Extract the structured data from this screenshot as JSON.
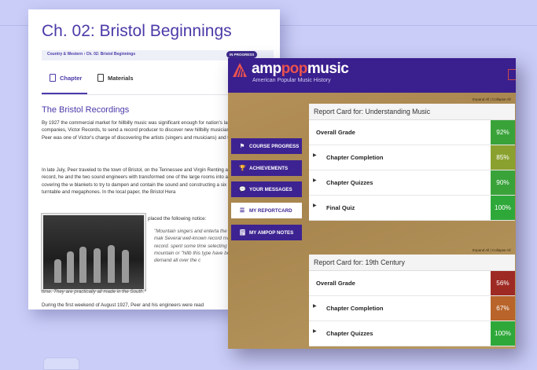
{
  "doc": {
    "title": "Ch. 02: Bristol Beginnings",
    "breadcrumb": "Country & Western › Ch. 02: Bristol Beginnings",
    "status_badge": "IN PROGRESS",
    "tabs": {
      "chapter": "Chapter",
      "materials": "Materials"
    },
    "section_title": "The Bristol Recordings",
    "para1": "By 1927 the commercial market for hillbilly music was significant enough for nation's largest record companies, Victor Records, to send a record producer to discover new hillbilly musicians to record. Ralph Peer was one of Victor's charge of discovering the artists (singers and musicians) and the repertoire music).",
    "para2": "In late July, Peer traveled to the town of Bristol, on the Tennessee and Virgin Renting a room where he could record, he and the two sound engineers with transformed one of the large rooms into a recording studio, covering the w blankets to try to dampen and contain the sound and constructing a six foo the recording turntable and megaphones. In the local paper, the Bristol Hera",
    "notice_intro": "placed the following notice:",
    "quote": "\"Mountain singers and enterta the talent used for record mak Several well-known record ma to Bristol this week to record. spent some time selecting the talent. The mountain or \"hillb this type have become more p in great demand all over the c",
    "quote_end": "time. They are practically all made in the South.\"",
    "para3": "During the first weekend of August 1927, Peer and his engineers were read"
  },
  "app": {
    "logo_amp": "amp",
    "logo_pop": "pop",
    "logo_music": "music",
    "logo_sub": "American Popular Music History",
    "sidebar": [
      {
        "label": "COURSE PROGRESS",
        "icon": "flag-icon",
        "glyph": "⚑"
      },
      {
        "label": "ACHIEVEMENTS",
        "icon": "trophy-icon",
        "glyph": "🏆"
      },
      {
        "label": "YOUR MESSAGES",
        "icon": "chat-icon",
        "glyph": "💬"
      },
      {
        "label": "MY REPORTCARD",
        "icon": "list-icon",
        "glyph": "☰"
      },
      {
        "label": "MY AMPOP NOTES",
        "icon": "notes-icon",
        "glyph": "🗒"
      }
    ],
    "expand_collapse": "Expand All | Collapse All",
    "cards": [
      {
        "title": "Report Card for: Understanding Music",
        "rows": [
          {
            "label": "Overall Grade",
            "pct": "92%",
            "color": "#39a33a",
            "expandable": false
          },
          {
            "label": "Chapter Completion",
            "pct": "85%",
            "color": "#8aa12f",
            "expandable": true
          },
          {
            "label": "Chapter Quizzes",
            "pct": "90%",
            "color": "#39a33a",
            "expandable": true
          },
          {
            "label": "Final Quiz",
            "pct": "100%",
            "color": "#2fa83a",
            "expandable": true
          }
        ]
      },
      {
        "title": "Report Card for: 19th Century",
        "rows": [
          {
            "label": "Overall Grade",
            "pct": "56%",
            "color": "#9e2a24",
            "expandable": false
          },
          {
            "label": "Chapter Completion",
            "pct": "67%",
            "color": "#b8642a",
            "expandable": true
          },
          {
            "label": "Chapter Quizzes",
            "pct": "100%",
            "color": "#2fa83a",
            "expandable": true
          }
        ]
      }
    ]
  }
}
